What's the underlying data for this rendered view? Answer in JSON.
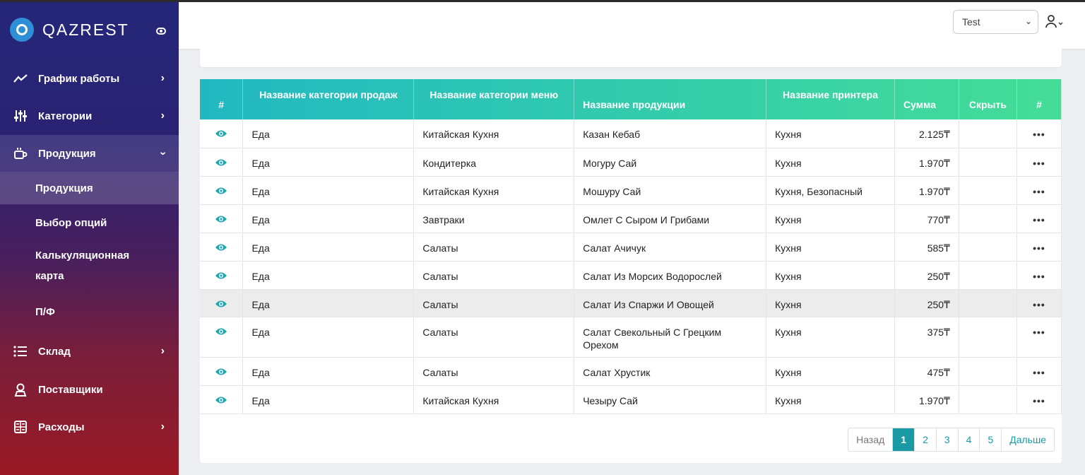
{
  "brand": {
    "name": "QAZREST"
  },
  "sidebar": {
    "items": [
      {
        "label": "График работы",
        "icon": "chart-line-icon",
        "has_arrow": true
      },
      {
        "label": "Категории",
        "icon": "sliders-icon",
        "has_arrow": true
      },
      {
        "label": "Продукция",
        "icon": "coffee-cup-icon",
        "expanded": true
      },
      {
        "label": "Склад",
        "icon": "list-icon",
        "has_arrow": true
      },
      {
        "label": "Поставщики",
        "icon": "user-badge-icon"
      },
      {
        "label": "Расходы",
        "icon": "calculator-icon",
        "has_arrow": true
      }
    ],
    "sub_items": [
      {
        "label": "Продукция",
        "active": true
      },
      {
        "label": "Выбор опций"
      },
      {
        "label_line1": "Калькуляционная",
        "label_line2": "карта"
      },
      {
        "label": "П/Ф"
      }
    ]
  },
  "topbar": {
    "select_value": "Test",
    "user_icon": "user-icon"
  },
  "table": {
    "headers": [
      "#",
      "Название категории продаж",
      "Название категории меню",
      "Название продукции",
      "Название принтера",
      "Сумма",
      "Скрыть",
      "#"
    ],
    "rows": [
      {
        "sales_cat": "Еда",
        "menu_cat": "Китайская Кухня",
        "product": "Казан Кебаб",
        "printer": "Кухня",
        "sum": "2.125₸"
      },
      {
        "sales_cat": "Еда",
        "menu_cat": "Кондитерка",
        "product": "Могуру Сай",
        "printer": "Кухня",
        "sum": "1.970₸"
      },
      {
        "sales_cat": "Еда",
        "menu_cat": "Китайская Кухня",
        "product": "Мошуру Сай",
        "printer": "Кухня, Безопасный",
        "sum": "1.970₸"
      },
      {
        "sales_cat": "Еда",
        "menu_cat": "Завтраки",
        "product": "Омлет С Сыром И Грибами",
        "printer": "Кухня",
        "sum": "770₸"
      },
      {
        "sales_cat": "Еда",
        "menu_cat": "Салаты",
        "product": "Салат Ачичук",
        "printer": "Кухня",
        "sum": "585₸"
      },
      {
        "sales_cat": "Еда",
        "menu_cat": "Салаты",
        "product": "Салат Из Морсих Водорослей",
        "printer": "Кухня",
        "sum": "250₸"
      },
      {
        "sales_cat": "Еда",
        "menu_cat": "Салаты",
        "product": "Салат Из Спаржи И Овощей",
        "printer": "Кухня",
        "sum": "250₸"
      },
      {
        "sales_cat": "Еда",
        "menu_cat": "Салаты",
        "product": "Салат Свекольный С Грецким Орехом",
        "printer": "Кухня",
        "sum": "375₸"
      },
      {
        "sales_cat": "Еда",
        "menu_cat": "Салаты",
        "product": "Салат Хрустик",
        "printer": "Кухня",
        "sum": "475₸"
      },
      {
        "sales_cat": "Еда",
        "menu_cat": "Китайская Кухня",
        "product": "Чезыру Сай",
        "printer": "Кухня",
        "sum": "1.970₸"
      }
    ]
  },
  "pagination": {
    "prev": "Назад",
    "pages": [
      "1",
      "2",
      "3",
      "4",
      "5"
    ],
    "next": "Дальше",
    "current": "1"
  },
  "colors": {
    "accent": "#1a9aa5",
    "header_start": "#22b8c2",
    "header_end": "#44dd98"
  }
}
